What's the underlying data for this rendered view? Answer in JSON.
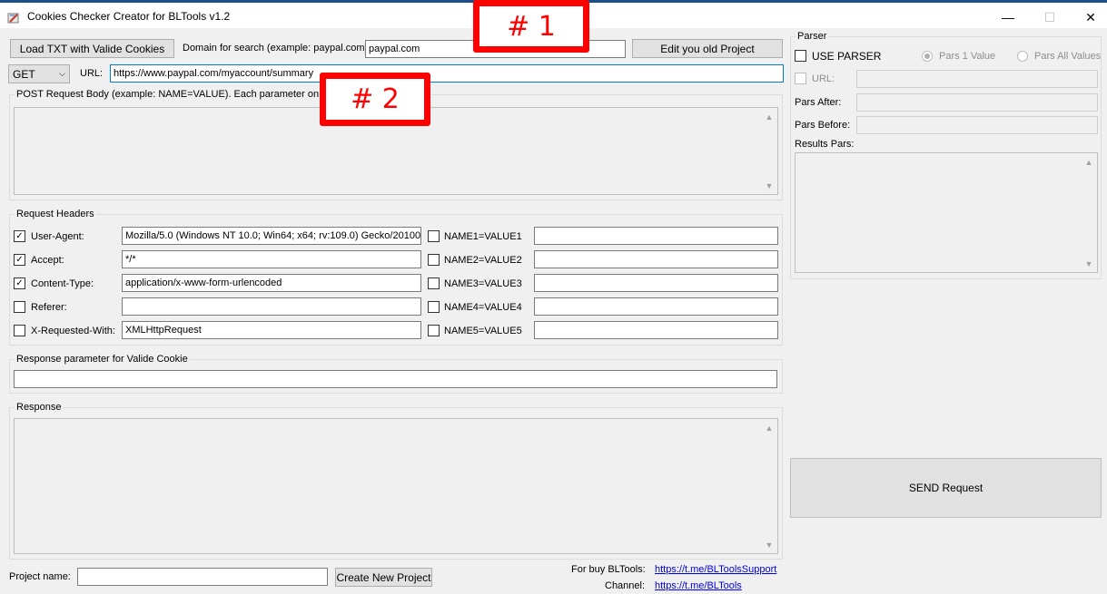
{
  "window": {
    "title": "Cookies Checker Creator for BLTools v1.2",
    "app_icon": "app-icon",
    "minimize": "—",
    "maximize": "☐",
    "close": "✕"
  },
  "toolbar": {
    "load_button": "Load TXT with Valide Cookies",
    "domain_label": "Domain for search (example: paypal.com):",
    "domain_value": "paypal.com",
    "edit_button": "Edit you old Project"
  },
  "request": {
    "method": "GET",
    "url_label": "URL:",
    "url_value": "https://www.paypal.com/myaccount/summary",
    "post_body_label": "POST Request Body (example: NAME=VALUE). Each parameter on a new line"
  },
  "headers": {
    "group_title": "Request Headers",
    "standard": [
      {
        "label": "User-Agent:",
        "checked": true,
        "value": "Mozilla/5.0 (Windows NT 10.0; Win64; x64; rv:109.0) Gecko/20100"
      },
      {
        "label": "Accept:",
        "checked": true,
        "value": "*/*"
      },
      {
        "label": "Content-Type:",
        "checked": true,
        "value": "application/x-www-form-urlencoded"
      },
      {
        "label": "Referer:",
        "checked": false,
        "value": ""
      },
      {
        "label": "X-Requested-With:",
        "checked": false,
        "value": "XMLHttpRequest"
      }
    ],
    "custom": [
      {
        "label": "NAME1=VALUE1",
        "checked": false,
        "value": ""
      },
      {
        "label": "NAME2=VALUE2",
        "checked": false,
        "value": ""
      },
      {
        "label": "NAME3=VALUE3",
        "checked": false,
        "value": ""
      },
      {
        "label": "NAME4=VALUE4",
        "checked": false,
        "value": ""
      },
      {
        "label": "NAME5=VALUE5",
        "checked": false,
        "value": ""
      }
    ]
  },
  "response_param": {
    "group_title": "Response parameter for Valide Cookie",
    "value": ""
  },
  "response": {
    "group_title": "Response"
  },
  "parser": {
    "group_title": "Parser",
    "use_parser_label": "USE PARSER",
    "use_parser_checked": false,
    "pars_1_label": "Pars 1 Value",
    "pars_1_selected": true,
    "pars_all_label": "Pars All Values",
    "pars_all_selected": false,
    "url_label": "URL:",
    "pars_after_label": "Pars After:",
    "pars_before_label": "Pars Before:",
    "results_label": "Results Pars:"
  },
  "send_button": "SEND Request",
  "footer": {
    "project_name_label": "Project name:",
    "project_name_value": "",
    "create_button": "Create New Project",
    "buy_label": "For buy BLTools:",
    "buy_link": "https://t.me/BLToolsSupport",
    "channel_label": "Channel:",
    "channel_link": "https://t.me/BLTools"
  },
  "annotations": {
    "marker_1": "# 1",
    "marker_2": "# 2",
    "color": "#ff0000"
  },
  "colors": {
    "accent_topline": "#1c4f8a",
    "link": "#0000ee"
  }
}
